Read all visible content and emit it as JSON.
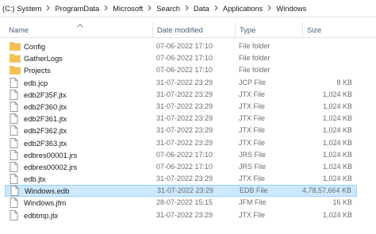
{
  "address_bar": {
    "crumbs": [
      "(C:) System",
      "ProgramData",
      "Microsoft",
      "Search",
      "Data",
      "Applications",
      "Windows"
    ],
    "separator_icon": "chevron-right-icon"
  },
  "columns": {
    "name": "Name",
    "date": "Date modified",
    "type": "Type",
    "size": "Size",
    "sort_icon": "sort-ascending-caret-icon"
  },
  "colors": {
    "folder": "#f4c24f",
    "selection_bg": "#cce8ff",
    "selection_border": "#99d1ff",
    "header_text": "#4c607a"
  },
  "files": [
    {
      "name": "Config",
      "date": "07-06-2022 17:10",
      "type": "File folder",
      "size": "",
      "icon": "folder-icon"
    },
    {
      "name": "GatherLogs",
      "date": "07-06-2022 17:10",
      "type": "File folder",
      "size": "",
      "icon": "folder-icon"
    },
    {
      "name": "Projects",
      "date": "07-06-2022 17:10",
      "type": "File folder",
      "size": "",
      "icon": "folder-icon"
    },
    {
      "name": "edb.jcp",
      "date": "31-07-2022 23:29",
      "type": "JCP File",
      "size": "8 KB",
      "icon": "file-icon"
    },
    {
      "name": "edb2F35F.jtx",
      "date": "31-07-2022 23:29",
      "type": "JTX File",
      "size": "1,024 KB",
      "icon": "file-icon"
    },
    {
      "name": "edb2F360.jtx",
      "date": "31-07-2022 23:29",
      "type": "JTX File",
      "size": "1,024 KB",
      "icon": "file-icon"
    },
    {
      "name": "edb2F361.jtx",
      "date": "31-07-2022 23:29",
      "type": "JTX File",
      "size": "1,024 KB",
      "icon": "file-icon"
    },
    {
      "name": "edb2F362.jtx",
      "date": "31-07-2022 23:29",
      "type": "JTX File",
      "size": "1,024 KB",
      "icon": "file-icon"
    },
    {
      "name": "edb2F363.jtx",
      "date": "31-07-2022 23:29",
      "type": "JTX File",
      "size": "1,024 KB",
      "icon": "file-icon"
    },
    {
      "name": "edbres00001.jrs",
      "date": "07-06-2022 17:10",
      "type": "JRS File",
      "size": "1,024 KB",
      "icon": "file-icon"
    },
    {
      "name": "edbres00002.jrs",
      "date": "07-06-2022 17:10",
      "type": "JRS File",
      "size": "1,024 KB",
      "icon": "file-icon"
    },
    {
      "name": "edb.jtx",
      "date": "31-07-2022 23:29",
      "type": "JTX File",
      "size": "1,024 KB",
      "icon": "file-icon"
    },
    {
      "name": "Windows.edb",
      "date": "31-07-2022 23:29",
      "type": "EDB File",
      "size": "4,78,57,664 KB",
      "icon": "file-icon",
      "selected": true
    },
    {
      "name": "Windows.jfm",
      "date": "28-07-2022 15:15",
      "type": "JFM File",
      "size": "16 KB",
      "icon": "file-icon"
    },
    {
      "name": "edbtmp.jtx",
      "date": "31-07-2022 23:29",
      "type": "JTX File",
      "size": "1,024 KB",
      "icon": "file-icon"
    }
  ]
}
